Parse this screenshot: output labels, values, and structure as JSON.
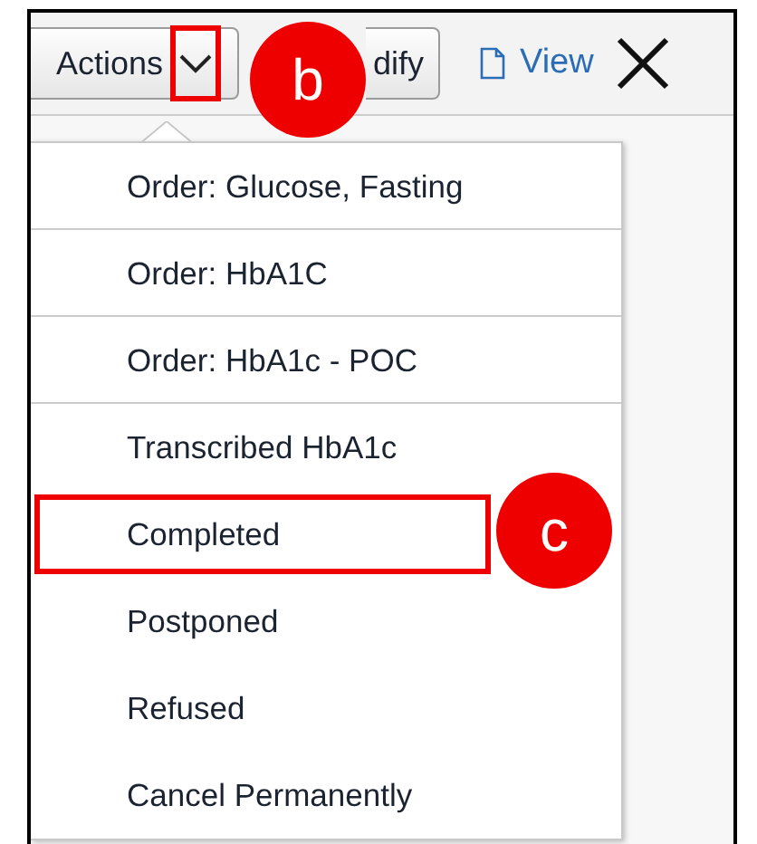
{
  "toolbar": {
    "actions_button": {
      "label": "Actions",
      "chevron_highlighted": true
    },
    "modify_button": {
      "label": "dify"
    },
    "view_link": {
      "label": "View"
    }
  },
  "menu": {
    "items": [
      {
        "label": "Order: Glucose, Fasting",
        "separator_after": true,
        "highlighted": false
      },
      {
        "label": "Order: HbA1C",
        "separator_after": true,
        "highlighted": false
      },
      {
        "label": "Order: HbA1c - POC",
        "separator_after": true,
        "highlighted": false
      },
      {
        "label": "Transcribed HbA1c",
        "separator_after": false,
        "highlighted": false
      },
      {
        "label": "Completed",
        "separator_after": false,
        "highlighted": true
      },
      {
        "label": "Postponed",
        "separator_after": false,
        "highlighted": false
      },
      {
        "label": "Refused",
        "separator_after": false,
        "highlighted": false
      },
      {
        "label": "Cancel Permanently",
        "separator_after": false,
        "highlighted": false
      }
    ]
  },
  "callouts": [
    {
      "label": "b"
    },
    {
      "label": "c"
    }
  ]
}
